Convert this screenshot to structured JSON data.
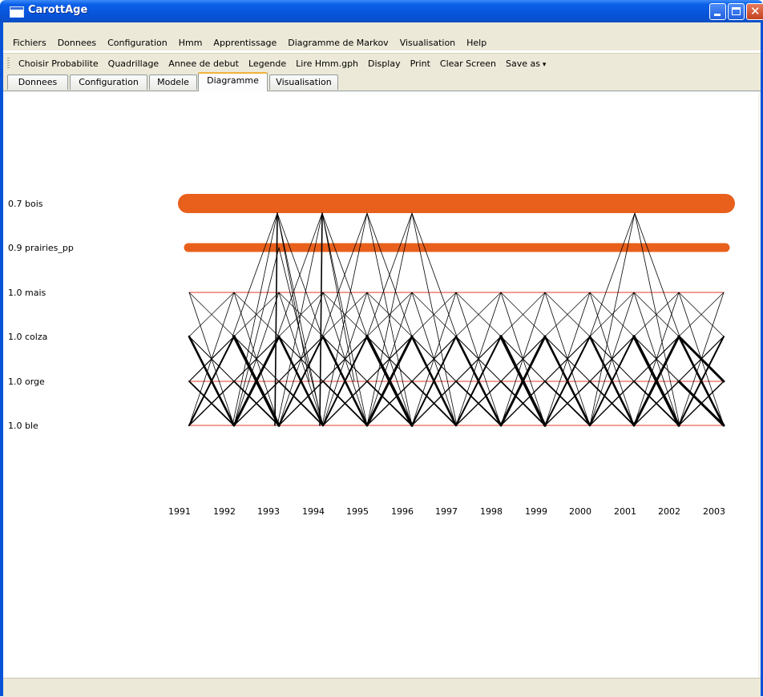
{
  "window": {
    "title": "CarottAge"
  },
  "menu": [
    "Fichiers",
    "Donnees",
    "Configuration",
    "Hmm",
    "Apprentissage",
    "Diagramme de Markov",
    "Visualisation",
    "Help"
  ],
  "toolbar": [
    "Choisir Probabilite",
    "Quadrillage",
    "Annee de debut",
    "Legende",
    "Lire Hmm.gph",
    "Display",
    "Print",
    "Clear Screen",
    "Save as"
  ],
  "tabs": [
    "Donnees",
    "Configuration",
    "Modele",
    "Diagramme",
    "Visualisation"
  ],
  "active_tab": "Diagramme",
  "colors": {
    "orange": "#e8601c",
    "thin_line": "#000000"
  },
  "chart_data": {
    "type": "markov-diagram",
    "states": [
      {
        "label": "0.7 bois",
        "value": 0.7,
        "name": "bois"
      },
      {
        "label": "0.9 prairies_pp",
        "value": 0.9,
        "name": "prairies_pp"
      },
      {
        "label": "1.0 mais",
        "value": 1.0,
        "name": "mais"
      },
      {
        "label": "1.0 colza",
        "value": 1.0,
        "name": "colza"
      },
      {
        "label": "1.0 orge",
        "value": 1.0,
        "name": "orge"
      },
      {
        "label": "1.0 ble",
        "value": 1.0,
        "name": "ble"
      }
    ],
    "years": [
      "1991",
      "1992",
      "1993",
      "1994",
      "1995",
      "1996",
      "1997",
      "1998",
      "1999",
      "2000",
      "2001",
      "2002",
      "2003"
    ]
  }
}
